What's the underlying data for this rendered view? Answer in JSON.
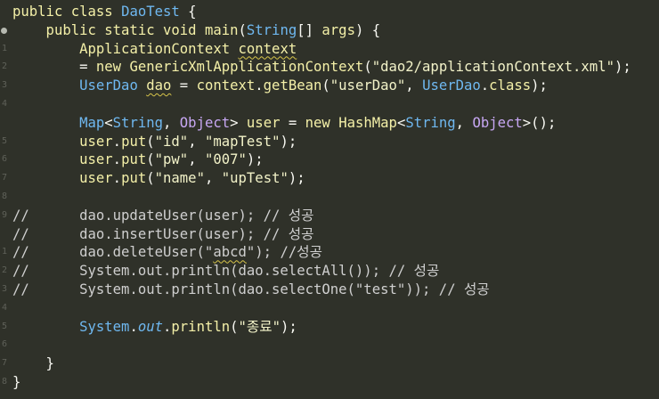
{
  "code_lines": [
    [
      {
        "t": "public class ",
        "c": "kw"
      },
      {
        "t": "DaoTest",
        "c": "type"
      },
      {
        "t": " {",
        "c": ""
      }
    ],
    [
      {
        "t": "    public static void ",
        "c": "kw"
      },
      {
        "t": "main",
        "c": "fn"
      },
      {
        "t": "(",
        "c": ""
      },
      {
        "t": "String",
        "c": "type"
      },
      {
        "t": "[] ",
        "c": ""
      },
      {
        "t": "args",
        "c": "param"
      },
      {
        "t": ") {",
        "c": ""
      }
    ],
    [
      {
        "t": "        ",
        "c": ""
      },
      {
        "t": "ApplicationContext",
        "c": "fn"
      },
      {
        "t": " ",
        "c": ""
      },
      {
        "t": "context",
        "c": "fn squig"
      }
    ],
    [
      {
        "t": "        = ",
        "c": ""
      },
      {
        "t": "new ",
        "c": "kw"
      },
      {
        "t": "GenericXmlApplicationContext",
        "c": "fn"
      },
      {
        "t": "(",
        "c": ""
      },
      {
        "t": "\"dao2/applicationContext.xml\"",
        "c": "str"
      },
      {
        "t": ");",
        "c": ""
      }
    ],
    [
      {
        "t": "        ",
        "c": ""
      },
      {
        "t": "UserDao",
        "c": "type"
      },
      {
        "t": " ",
        "c": ""
      },
      {
        "t": "dao",
        "c": "fn squig"
      },
      {
        "t": " = ",
        "c": ""
      },
      {
        "t": "context",
        "c": "fn"
      },
      {
        "t": ".",
        "c": ""
      },
      {
        "t": "getBean",
        "c": "fn"
      },
      {
        "t": "(",
        "c": ""
      },
      {
        "t": "\"userDao\"",
        "c": "str"
      },
      {
        "t": ", ",
        "c": ""
      },
      {
        "t": "UserDao",
        "c": "type"
      },
      {
        "t": ".",
        "c": ""
      },
      {
        "t": "class",
        "c": "kw"
      },
      {
        "t": ");",
        "c": ""
      }
    ],
    [],
    [
      {
        "t": "        ",
        "c": ""
      },
      {
        "t": "Map",
        "c": "type"
      },
      {
        "t": "<",
        "c": ""
      },
      {
        "t": "String",
        "c": "type"
      },
      {
        "t": ", ",
        "c": ""
      },
      {
        "t": "Object",
        "c": "cls2"
      },
      {
        "t": "> ",
        "c": ""
      },
      {
        "t": "user",
        "c": "fn"
      },
      {
        "t": " = ",
        "c": ""
      },
      {
        "t": "new ",
        "c": "kw"
      },
      {
        "t": "HashMap",
        "c": "fn"
      },
      {
        "t": "<",
        "c": ""
      },
      {
        "t": "String",
        "c": "type"
      },
      {
        "t": ", ",
        "c": ""
      },
      {
        "t": "Object",
        "c": "cls2"
      },
      {
        "t": ">();",
        "c": ""
      }
    ],
    [
      {
        "t": "        ",
        "c": ""
      },
      {
        "t": "user",
        "c": "fn"
      },
      {
        "t": ".",
        "c": ""
      },
      {
        "t": "put",
        "c": "fn"
      },
      {
        "t": "(",
        "c": ""
      },
      {
        "t": "\"id\"",
        "c": "str"
      },
      {
        "t": ", ",
        "c": ""
      },
      {
        "t": "\"mapTest\"",
        "c": "str"
      },
      {
        "t": ");",
        "c": ""
      }
    ],
    [
      {
        "t": "        ",
        "c": ""
      },
      {
        "t": "user",
        "c": "fn"
      },
      {
        "t": ".",
        "c": ""
      },
      {
        "t": "put",
        "c": "fn"
      },
      {
        "t": "(",
        "c": ""
      },
      {
        "t": "\"pw\"",
        "c": "str"
      },
      {
        "t": ", ",
        "c": ""
      },
      {
        "t": "\"007\"",
        "c": "str"
      },
      {
        "t": ");",
        "c": ""
      }
    ],
    [
      {
        "t": "        ",
        "c": ""
      },
      {
        "t": "user",
        "c": "fn"
      },
      {
        "t": ".",
        "c": ""
      },
      {
        "t": "put",
        "c": "fn"
      },
      {
        "t": "(",
        "c": ""
      },
      {
        "t": "\"name\"",
        "c": "str"
      },
      {
        "t": ", ",
        "c": ""
      },
      {
        "t": "\"upTest\"",
        "c": "str"
      },
      {
        "t": ");",
        "c": ""
      }
    ],
    [],
    [
      {
        "t": "//      dao.updateUser(user); // 성공",
        "c": "cmt"
      }
    ],
    [
      {
        "t": "//      dao.insertUser(user); // 성공",
        "c": "cmt"
      }
    ],
    [
      {
        "t": "//      dao.deleteUser(\"",
        "c": "cmt"
      },
      {
        "t": "abcd",
        "c": "cmt squig"
      },
      {
        "t": "\"); //성공",
        "c": "cmt"
      }
    ],
    [
      {
        "t": "//      System.out.println(dao.selectAll()); // 성공",
        "c": "cmt"
      }
    ],
    [
      {
        "t": "//      System.out.println(dao.selectOne(\"test\")); // 성공",
        "c": "cmt"
      }
    ],
    [],
    [
      {
        "t": "        ",
        "c": ""
      },
      {
        "t": "System",
        "c": "type"
      },
      {
        "t": ".",
        "c": ""
      },
      {
        "t": "out",
        "c": "ital"
      },
      {
        "t": ".",
        "c": ""
      },
      {
        "t": "println",
        "c": "fn"
      },
      {
        "t": "(",
        "c": ""
      },
      {
        "t": "\"종료\"",
        "c": "str"
      },
      {
        "t": ");",
        "c": ""
      }
    ],
    [],
    [
      {
        "t": "    }",
        "c": ""
      }
    ],
    [
      {
        "t": "}",
        "c": ""
      }
    ]
  ],
  "gutter_marks": [
    "",
    "",
    "1",
    "2",
    "3",
    "4",
    "",
    "5",
    "6",
    "7",
    "8",
    "9",
    "",
    "1",
    "2",
    "3",
    "4",
    "5",
    "6",
    "7",
    "8"
  ]
}
